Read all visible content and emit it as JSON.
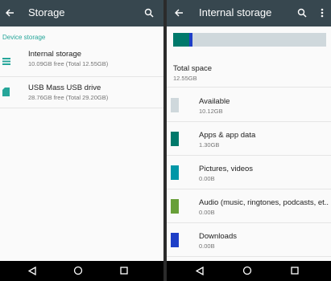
{
  "left": {
    "title": "Storage",
    "section_header": "Device storage",
    "items": [
      {
        "title": "Internal storage",
        "subtitle": "10.09GB free (Total 12.55GB)",
        "icon": "storage-list-icon"
      },
      {
        "title": "USB Mass USB drive",
        "subtitle": "28.76GB free (Total 29.20GB)",
        "icon": "sd-card-icon"
      }
    ]
  },
  "right": {
    "title": "Internal storage",
    "usage_bar": {
      "segments": [
        {
          "label": "Apps & app data",
          "fraction": 0.104,
          "color": "#00796b"
        },
        {
          "label": "Pictures, videos",
          "fraction": 0.0,
          "color": "#0097a7"
        },
        {
          "label": "Audio",
          "fraction": 0.0,
          "color": "#689f38"
        },
        {
          "label": "Downloads",
          "fraction": 0.02,
          "color": "#1e3fc7"
        }
      ],
      "track_color": "#cfd8dc"
    },
    "total_label": "Total space",
    "total_value": "12.55GB",
    "categories": [
      {
        "title": "Available",
        "size": "10.12GB",
        "color": "#cfd8dc"
      },
      {
        "title": "Apps & app data",
        "size": "1.30GB",
        "color": "#00796b"
      },
      {
        "title": "Pictures, videos",
        "size": "0.00B",
        "color": "#0097a7"
      },
      {
        "title": "Audio (music, ringtones, podcasts, et..",
        "size": "0.00B",
        "color": "#689f38"
      },
      {
        "title": "Downloads",
        "size": "0.00B",
        "color": "#1e3fc7"
      }
    ]
  },
  "colors": {
    "appbar": "#37474f",
    "accent": "#26a69a",
    "navbar": "#000000"
  }
}
